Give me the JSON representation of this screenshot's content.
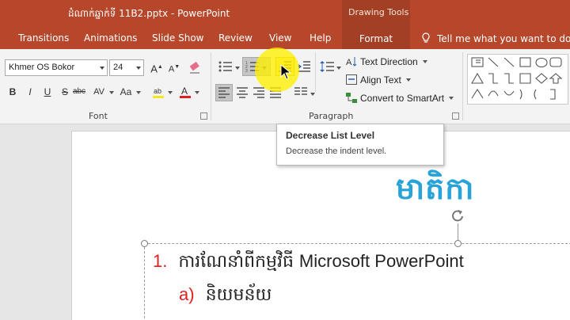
{
  "window": {
    "title": "ដំណាក់ឆ្នាក់ទី 11B2.pptx  -  PowerPoint",
    "context_tab_group": "Drawing Tools"
  },
  "tabs": [
    {
      "label": "Transitions"
    },
    {
      "label": "Animations"
    },
    {
      "label": "Slide Show"
    },
    {
      "label": "Review"
    },
    {
      "label": "View"
    },
    {
      "label": "Help"
    },
    {
      "label": "Format"
    }
  ],
  "tell_me": "Tell me what you want to do",
  "ribbon": {
    "font": {
      "label": "Font",
      "font_name": "Khmer OS Bokor",
      "font_size": "24",
      "buttons": {
        "bold": "B",
        "italic": "I",
        "underline": "U",
        "strikethrough": "S",
        "spacing": "AV",
        "case": "Aa"
      }
    },
    "paragraph": {
      "label": "Paragraph",
      "text_direction": "Text Direction",
      "align_text": "Align Text",
      "convert_smartart": "Convert to SmartArt"
    }
  },
  "tooltip": {
    "title": "Decrease List Level",
    "description": "Decrease the indent level."
  },
  "slide": {
    "title": "មាតិកា",
    "items": [
      {
        "number": "1.",
        "text_khmer": "ការណែនាំពីកម្មវិធី",
        "text_latin": "Microsoft PowerPoint"
      },
      {
        "number": "a)",
        "text_khmer": "និយមន័យ"
      }
    ]
  },
  "colors": {
    "ribbon_accent": "#b7472a",
    "slide_title": "#28a3d8",
    "list_number": "#e0201f",
    "cursor_highlight": "#fff000"
  }
}
